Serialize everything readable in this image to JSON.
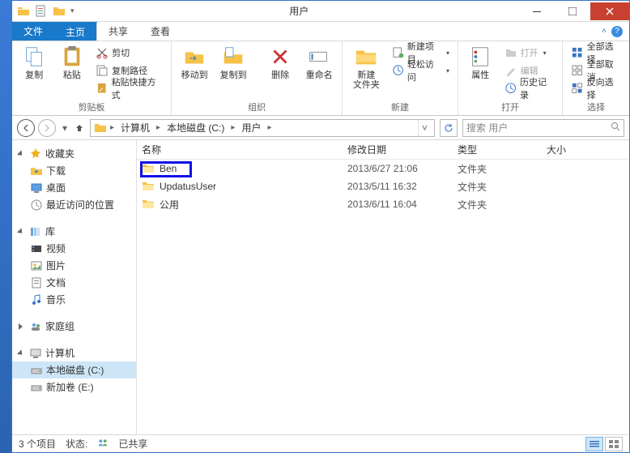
{
  "window": {
    "title": "用户",
    "tabs": {
      "file": "文件",
      "home": "主页",
      "share": "共享",
      "view": "查看"
    }
  },
  "ribbon": {
    "clipboard": {
      "label": "剪贴板",
      "copy": "复制",
      "paste": "粘贴",
      "cut": "剪切",
      "copy_path": "复制路径",
      "paste_shortcut": "粘贴快捷方式"
    },
    "organize": {
      "label": "组织",
      "move_to": "移动到",
      "copy_to": "复制到",
      "delete": "删除",
      "rename": "重命名"
    },
    "new": {
      "label": "新建",
      "new_folder": "新建\n文件夹",
      "new_item": "新建项目",
      "easy_access": "轻松访问"
    },
    "open": {
      "label": "打开",
      "properties": "属性",
      "open": "打开",
      "edit": "编辑",
      "history": "历史记录"
    },
    "select": {
      "label": "选择",
      "select_all": "全部选择",
      "select_none": "全部取消",
      "invert": "反向选择"
    }
  },
  "address": {
    "crumbs": [
      "计算机",
      "本地磁盘 (C:)",
      "用户"
    ],
    "search_placeholder": "搜索 用户"
  },
  "nav": {
    "favorites": "收藏夹",
    "downloads": "下载",
    "desktop": "桌面",
    "recent": "最近访问的位置",
    "libraries": "库",
    "videos": "视频",
    "pictures": "图片",
    "documents": "文档",
    "music": "音乐",
    "homegroup": "家庭组",
    "computer": "计算机",
    "drive_c": "本地磁盘 (C:)",
    "drive_e": "新加卷 (E:)"
  },
  "columns": {
    "name": "名称",
    "modified": "修改日期",
    "type": "类型",
    "size": "大小"
  },
  "type_folder": "文件夹",
  "files": [
    {
      "name": "Ben",
      "modified": "2013/6/27 21:06"
    },
    {
      "name": "UpdatusUser",
      "modified": "2013/5/11 16:32"
    },
    {
      "name": "公用",
      "modified": "2013/6/11 16:04"
    }
  ],
  "status": {
    "items": "3 个项目",
    "state_label": "状态:",
    "shared": "已共享"
  }
}
